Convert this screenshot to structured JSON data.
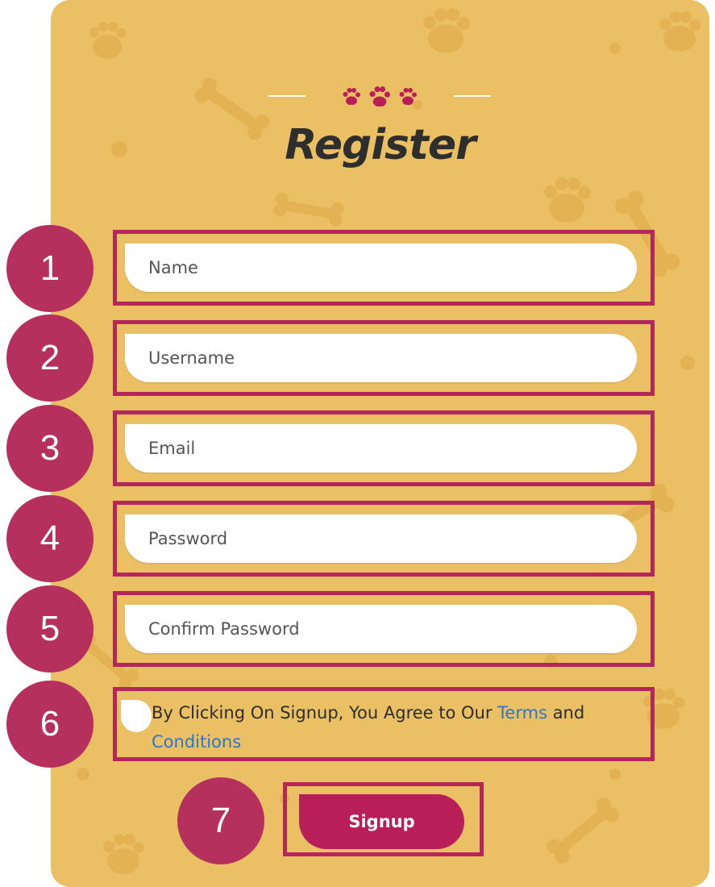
{
  "colors": {
    "card_bg": "#ebbf63",
    "accent": "#b81f58",
    "annotation": "#b5305d",
    "link": "#2f76c9",
    "pattern": "#e2ad4e"
  },
  "header": {
    "decoration_icons": [
      "paw-icon",
      "paw-icon",
      "paw-icon"
    ],
    "title": "Register"
  },
  "form": {
    "name": {
      "placeholder": "Name",
      "value": ""
    },
    "username": {
      "placeholder": "Username",
      "value": ""
    },
    "email": {
      "placeholder": "Email",
      "value": ""
    },
    "password": {
      "placeholder": "Password",
      "value": ""
    },
    "confirm_password": {
      "placeholder": "Confirm Password",
      "value": ""
    },
    "agree": {
      "checked": false,
      "text_before": "By Clicking On Signup, You Agree to Our ",
      "terms_link": "Terms",
      "text_and": " and",
      "conditions_link": "Conditions"
    },
    "signup_label": "Signup"
  },
  "annotations": [
    "1",
    "2",
    "3",
    "4",
    "5",
    "6",
    "7"
  ]
}
